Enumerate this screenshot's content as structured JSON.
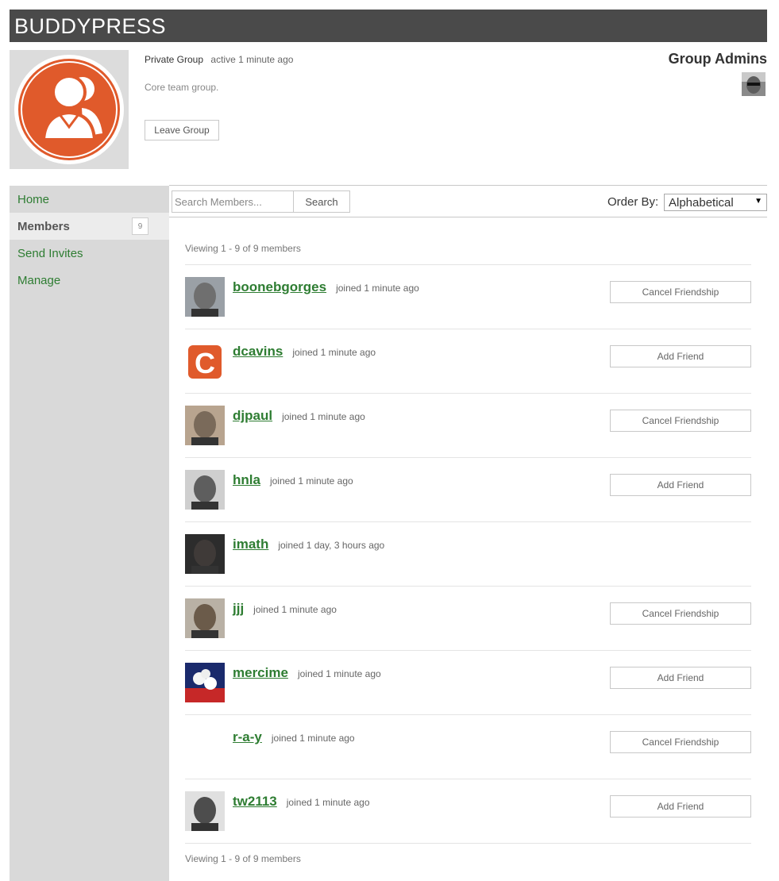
{
  "site": {
    "title": "BUDDYPRESS"
  },
  "group": {
    "type": "Private Group",
    "activity": "active 1 minute ago",
    "description": "Core team group.",
    "leave_label": "Leave Group",
    "admins_heading": "Group Admins",
    "admin_avatar_icon": "user-photo",
    "brand_color": "#e05a2b"
  },
  "nav": {
    "items": [
      {
        "label": "Home",
        "current": false
      },
      {
        "label": "Members",
        "current": true,
        "count": "9"
      },
      {
        "label": "Send Invites",
        "current": false
      },
      {
        "label": "Manage",
        "current": false
      }
    ]
  },
  "filters": {
    "search_placeholder": "Search Members...",
    "search_button": "Search",
    "order_label": "Order By:",
    "order_selected": "Alphabetical"
  },
  "pagination": {
    "count_text": "Viewing 1 - 9 of 9 members"
  },
  "members": [
    {
      "name": "boonebgorges",
      "joined": "joined 1 minute ago",
      "action": "Cancel Friendship",
      "avatar": "photo"
    },
    {
      "name": "dcavins",
      "joined": "joined 1 minute ago",
      "action": "Add Friend",
      "avatar": "letter-c"
    },
    {
      "name": "djpaul",
      "joined": "joined 1 minute ago",
      "action": "Cancel Friendship",
      "avatar": "photo"
    },
    {
      "name": "hnla",
      "joined": "joined 1 minute ago",
      "action": "Add Friend",
      "avatar": "photo"
    },
    {
      "name": "imath",
      "joined": "joined 1 day, 3 hours ago",
      "action": "",
      "avatar": "photo"
    },
    {
      "name": "jjj",
      "joined": "joined 1 minute ago",
      "action": "Cancel Friendship",
      "avatar": "photo"
    },
    {
      "name": "mercime",
      "joined": "joined 1 minute ago",
      "action": "Add Friend",
      "avatar": "flowers"
    },
    {
      "name": "r-a-y",
      "joined": "joined 1 minute ago",
      "action": "Cancel Friendship",
      "avatar": "none"
    },
    {
      "name": "tw2113",
      "joined": "joined 1 minute ago",
      "action": "Add Friend",
      "avatar": "photo"
    }
  ]
}
